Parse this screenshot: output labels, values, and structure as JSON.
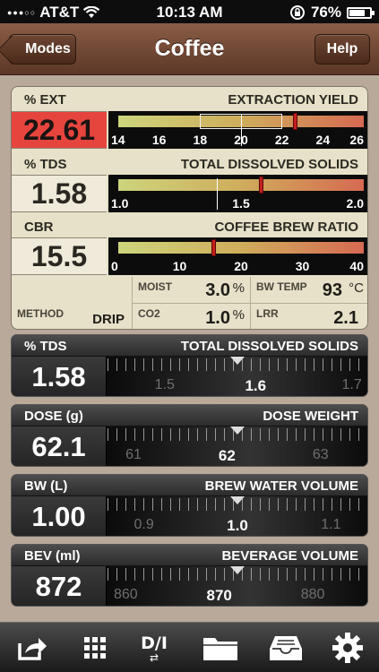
{
  "status": {
    "carrier": "AT&T",
    "time": "10:13 AM",
    "battery": "76%",
    "battery_level": 0.76
  },
  "nav": {
    "back_label": "Modes",
    "title": "Coffee",
    "help_label": "Help"
  },
  "extraction": {
    "label": "% EXT",
    "title": "EXTRACTION YIELD",
    "value": "22.61",
    "ticks": [
      "14",
      "16",
      "18",
      "20",
      "22",
      "24",
      "26"
    ],
    "min": 14,
    "max": 26,
    "indicator": 22.61,
    "target_line": 20,
    "ideal_range": [
      18,
      22
    ]
  },
  "tds": {
    "label": "% TDS",
    "title": "TOTAL DISSOLVED SOLIDS",
    "value": "1.58",
    "ticks": [
      "1.0",
      "1.5",
      "2.0"
    ],
    "min": 1.0,
    "max": 2.0,
    "indicator": 1.58,
    "target_line": 1.4
  },
  "cbr": {
    "label": "CBR",
    "title": "COFFEE BREW RATIO",
    "value": "15.5",
    "ticks": [
      "0",
      "10",
      "20",
      "30",
      "40"
    ],
    "min": 0,
    "max": 40,
    "indicator": 15.5
  },
  "info": {
    "method_label": "METHOD",
    "method_value": "DRIP",
    "moist_label": "MOIST",
    "moist_value": "3.0",
    "moist_unit": "%",
    "bwtemp_label": "BW TEMP",
    "bwtemp_value": "93",
    "bwtemp_unit": "°C",
    "co2_label": "CO2",
    "co2_value": "1.0",
    "co2_unit": "%",
    "lrr_label": "LRR",
    "lrr_value": "2.1"
  },
  "rows": [
    {
      "label": "% TDS",
      "title": "TOTAL DISSOLVED SOLIDS",
      "value": "1.58",
      "scale": [
        "1.5",
        "1.6",
        "1.7"
      ]
    },
    {
      "label": "DOSE (g)",
      "title": "DOSE WEIGHT",
      "value": "62.1",
      "scale": [
        "61",
        "62",
        "63"
      ]
    },
    {
      "label": "BW (L)",
      "title": "BREW WATER VOLUME",
      "value": "1.00",
      "scale": [
        "0.9",
        "1.0",
        "1.1"
      ]
    },
    {
      "label": "BEV (ml)",
      "title": "BEVERAGE VOLUME",
      "value": "872",
      "scale": [
        "860",
        "870",
        "880"
      ]
    }
  ],
  "tabbar": {
    "items": [
      "share-icon",
      "grid-icon",
      "di-icon",
      "folder-icon",
      "inbox-icon",
      "gear-icon"
    ],
    "di_label": "D/I"
  }
}
